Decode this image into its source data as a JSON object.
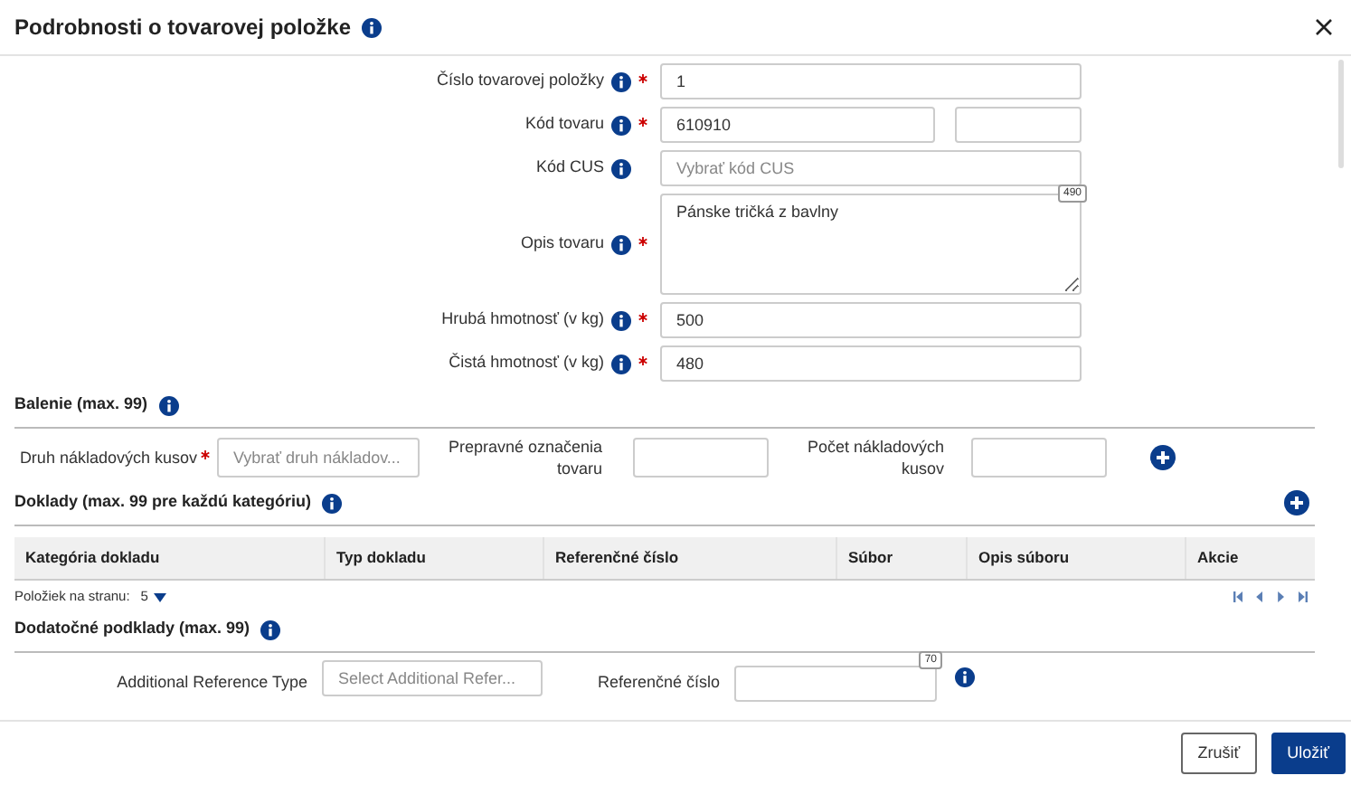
{
  "dialog": {
    "title": "Podrobnosti o tovarovej položke"
  },
  "fields": [
    {
      "kind": "input",
      "label": "Číslo tovarovej položky",
      "info": true,
      "required": true,
      "value": "1"
    },
    {
      "kind": "split",
      "label": "Kód tovaru",
      "info": true,
      "required": true,
      "value": "610910"
    },
    {
      "kind": "input",
      "label": "Kód CUS",
      "info": true,
      "required": false,
      "placeholder": "Vybrať kód CUS"
    },
    {
      "kind": "textarea",
      "label": "Opis tovaru",
      "info": true,
      "required": true,
      "value": "Pánske tričká z bavlny",
      "counter": "490"
    },
    {
      "kind": "input",
      "label": "Hrubá hmotnosť (v kg)",
      "info": true,
      "required": true,
      "value": "500"
    },
    {
      "kind": "input",
      "label": "Čistá hmotnosť (v kg)",
      "info": true,
      "required": true,
      "value": "480"
    }
  ],
  "packaging": {
    "title": "Balenie (max. 99)",
    "fields": [
      {
        "label": "Druh nákladových kusov",
        "required": true,
        "placeholder": "Vybrať druh nákladov..."
      },
      {
        "label": "Prepravné označenia tovaru",
        "required": false
      },
      {
        "label": "Počet nákladových kusov",
        "required": false
      }
    ]
  },
  "documents": {
    "title": "Doklady (max. 99 pre každú kategóriu)",
    "columns": [
      "Kategória dokladu",
      "Typ dokladu",
      "Referenčné číslo",
      "Súbor",
      "Opis súboru",
      "Akcie"
    ],
    "page_size_label": "Položiek na stranu:",
    "page_size": "5"
  },
  "additional": {
    "title": "Dodatočné podklady (max. 99)",
    "type_label": "Additional Reference Type",
    "type_placeholder": "Select Additional Refer...",
    "ref_label": "Referenčné číslo",
    "counter": "70"
  },
  "buttons": [
    {
      "label": "Zrušiť",
      "kind": "secondary"
    },
    {
      "label": "Uložiť",
      "kind": "primary"
    }
  ]
}
